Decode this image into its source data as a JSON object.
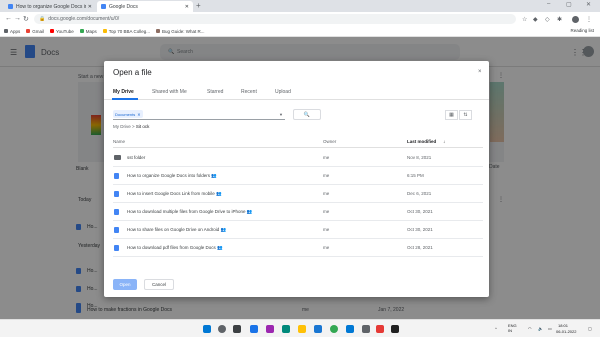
{
  "browser": {
    "tabs": [
      {
        "label": "How to organize Google Docs in a..",
        "active": false
      },
      {
        "label": "Google Docs",
        "active": true
      }
    ],
    "new_tab": "+",
    "window_controls": [
      "–",
      "▢",
      "✕"
    ],
    "url": "docs.google.com/document/u/0/",
    "bookmarks": [
      {
        "label": "Apps",
        "color": "#5f6368"
      },
      {
        "label": "Gmail",
        "color": "#ea4335"
      },
      {
        "label": "YouTube",
        "color": "#ff0000"
      },
      {
        "label": "Maps",
        "color": "#34a853"
      },
      {
        "label": "Top 70 BBA Colleg...",
        "color": "#fbbc04"
      },
      {
        "label": "Bug Guide: What R...",
        "color": "#8d6e63"
      }
    ],
    "reading_list": "Reading list"
  },
  "docs_header": {
    "app_name": "Docs",
    "search_placeholder": "Search"
  },
  "background": {
    "start_new": "Start a new document",
    "today_label": "Today",
    "yesterday_label": "Yesterday",
    "list_heading": "Blank",
    "right_col": "Date",
    "rows": [
      {
        "name": "Ho...",
        "owner": "",
        "date": ""
      },
      {
        "name": "Ho...",
        "owner": "",
        "date": ""
      },
      {
        "name": "Ho...",
        "owner": "",
        "date": ""
      },
      {
        "name": "Ho...",
        "owner": "",
        "date": ""
      },
      {
        "name": "How to make fractions in Google Docs",
        "owner": "me",
        "date": "Jan 7, 2022"
      }
    ]
  },
  "modal": {
    "title": "Open a file",
    "close_icon": "×",
    "tabs": [
      "My Drive",
      "Shared with Me",
      "Starred",
      "Recent",
      "Upload"
    ],
    "active_tab": 0,
    "filter_chip": "Documents",
    "breadcrumb": {
      "root": "My Drive",
      "separator": ">",
      "current": "Sit ock"
    },
    "columns": {
      "name": "Name",
      "owner": "Owner",
      "modified": "Last modified",
      "sort_icon": "↓"
    },
    "files": [
      {
        "type": "folder",
        "name": "sst folder",
        "owner": "me",
        "date": "Nov 8, 2021"
      },
      {
        "type": "doc",
        "name": "How to organize Google Docs into folders  👥",
        "owner": "me",
        "date": "6:15 PM"
      },
      {
        "type": "doc",
        "name": "How to insert Google Docs Link from mobile  👥",
        "owner": "me",
        "date": "Dec 6, 2021"
      },
      {
        "type": "doc",
        "name": "How to download multiple files from Google Drive to iPhone  👥",
        "owner": "me",
        "date": "Oct 30, 2021"
      },
      {
        "type": "doc",
        "name": "How to share files on Google Drive on Android  👥",
        "owner": "me",
        "date": "Oct 30, 2021"
      },
      {
        "type": "doc",
        "name": "How to download pdf files from Google Docs  👥",
        "owner": "me",
        "date": "Oct 28, 2021"
      }
    ],
    "open_button": "Open",
    "cancel_button": "Cancel"
  },
  "taskbar": {
    "tray_lang": "ENG\nIN",
    "time": "18:01",
    "date": "06-01-2022"
  }
}
